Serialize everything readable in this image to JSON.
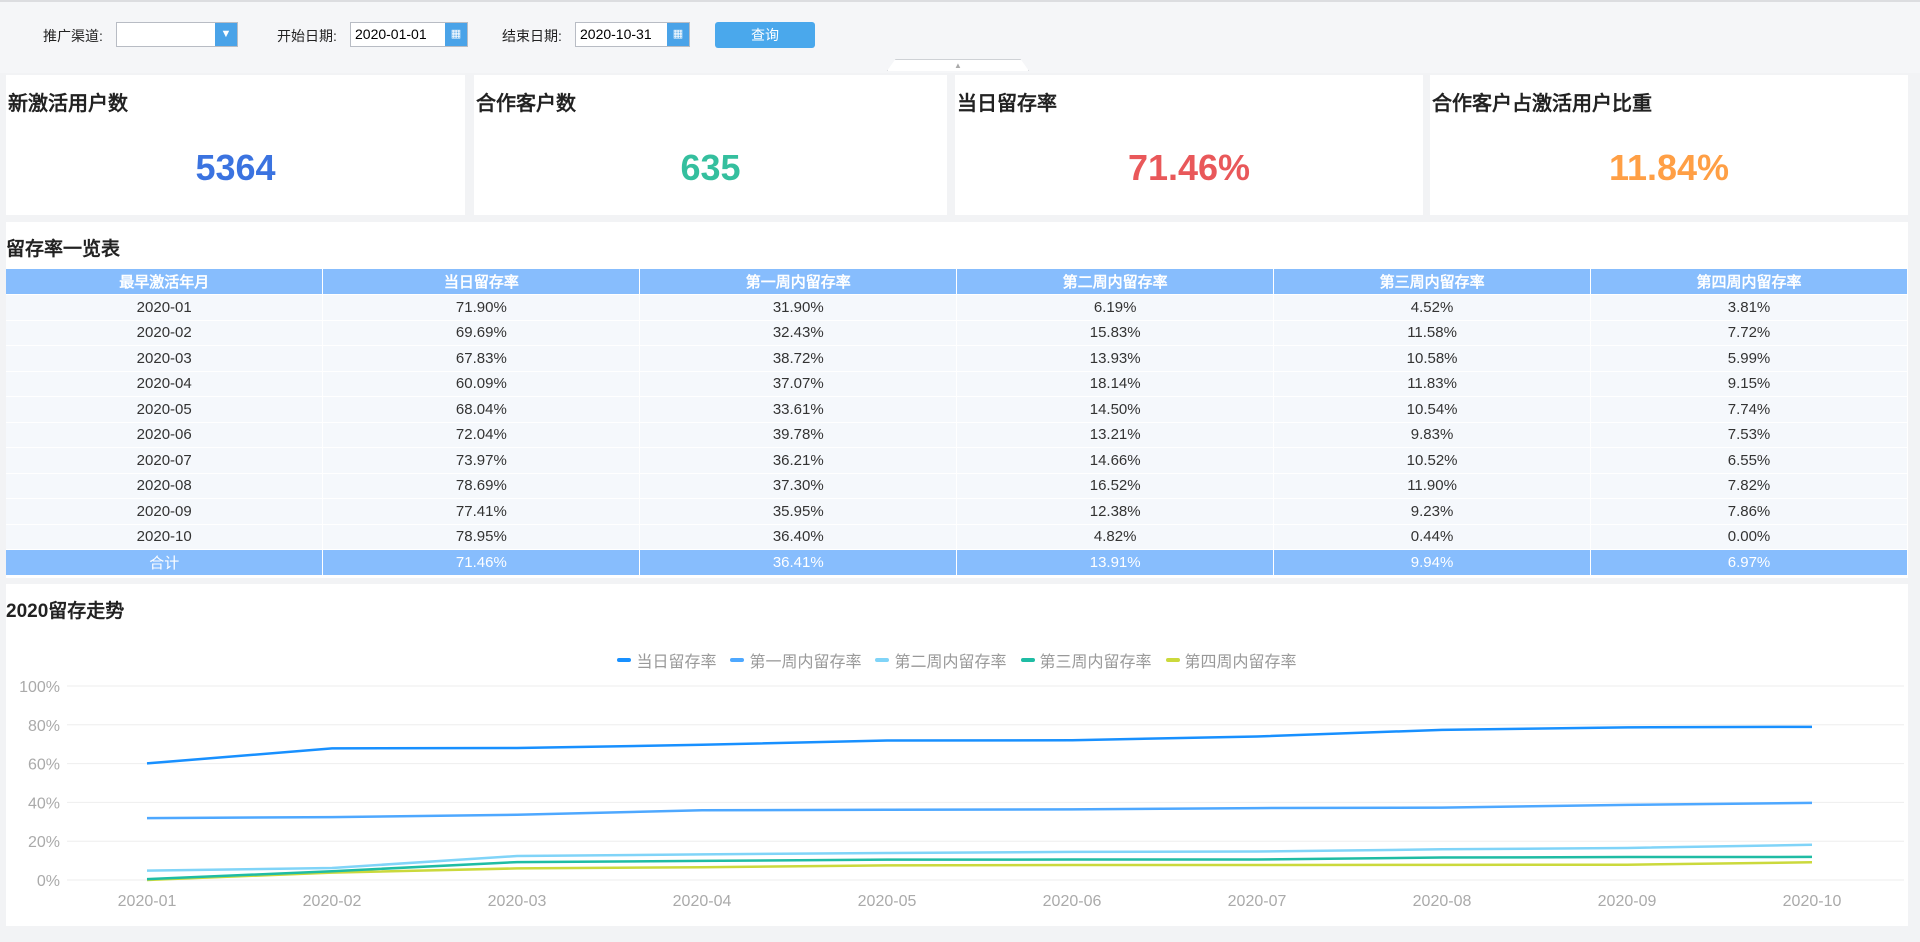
{
  "filters": {
    "channel_label": "推广渠道:",
    "channel_value": "",
    "start_label": "开始日期:",
    "start_value": "2020-01-01",
    "end_label": "结束日期:",
    "end_value": "2020-10-31",
    "query_button": "查询",
    "collapse_icon": "▲"
  },
  "cards": [
    {
      "title": "新激活用户数",
      "value": "5364",
      "color": "#3b73e0"
    },
    {
      "title": "合作客户数",
      "value": "635",
      "color": "#34bf9e"
    },
    {
      "title": "当日留存率",
      "value": "71.46%",
      "color": "#e9585a"
    },
    {
      "title": "合作客户占激活用户比重",
      "value": "11.84%",
      "color": "#ff9f45"
    }
  ],
  "table": {
    "title": "留存率一览表",
    "headers": [
      "最早激活年月",
      "当日留存率",
      "第一周内留存率",
      "第二周内留存率",
      "第三周内留存率",
      "第四周内留存率"
    ],
    "rows": [
      [
        "2020-01",
        "71.90%",
        "31.90%",
        "6.19%",
        "4.52%",
        "3.81%"
      ],
      [
        "2020-02",
        "69.69%",
        "32.43%",
        "15.83%",
        "11.58%",
        "7.72%"
      ],
      [
        "2020-03",
        "67.83%",
        "38.72%",
        "13.93%",
        "10.58%",
        "5.99%"
      ],
      [
        "2020-04",
        "60.09%",
        "37.07%",
        "18.14%",
        "11.83%",
        "9.15%"
      ],
      [
        "2020-05",
        "68.04%",
        "33.61%",
        "14.50%",
        "10.54%",
        "7.74%"
      ],
      [
        "2020-06",
        "72.04%",
        "39.78%",
        "13.21%",
        "9.83%",
        "7.53%"
      ],
      [
        "2020-07",
        "73.97%",
        "36.21%",
        "14.66%",
        "10.52%",
        "6.55%"
      ],
      [
        "2020-08",
        "78.69%",
        "37.30%",
        "16.52%",
        "11.90%",
        "7.82%"
      ],
      [
        "2020-09",
        "77.41%",
        "35.95%",
        "12.38%",
        "9.23%",
        "7.86%"
      ],
      [
        "2020-10",
        "78.95%",
        "36.40%",
        "4.82%",
        "0.44%",
        "0.00%"
      ]
    ],
    "total": [
      "合计",
      "71.46%",
      "36.41%",
      "13.91%",
      "9.94%",
      "6.97%"
    ]
  },
  "chart_title": "2020留存走势",
  "chart_data": {
    "type": "line",
    "title": "2020留存走势",
    "legend_position": "top-center",
    "grid": true,
    "x": [
      "2020-01",
      "2020-02",
      "2020-03",
      "2020-04",
      "2020-05",
      "2020-06",
      "2020-07",
      "2020-08",
      "2020-09",
      "2020-10"
    ],
    "ylim": [
      0,
      100
    ],
    "yticks": [
      "0%",
      "20%",
      "40%",
      "60%",
      "80%",
      "100%"
    ],
    "series": [
      {
        "name": "当日留存率",
        "color": "#1890ff",
        "values": [
          60.09,
          67.83,
          68.04,
          69.69,
          71.9,
          72.04,
          73.97,
          77.41,
          78.69,
          78.95
        ]
      },
      {
        "name": "第一周内留存率",
        "color": "#4ea8ff",
        "values": [
          31.9,
          32.43,
          33.61,
          35.95,
          36.21,
          36.4,
          37.07,
          37.3,
          38.72,
          39.78
        ]
      },
      {
        "name": "第二周内留存率",
        "color": "#80d4f8",
        "values": [
          4.82,
          6.19,
          12.38,
          13.21,
          13.93,
          14.5,
          14.66,
          15.83,
          16.52,
          18.14
        ]
      },
      {
        "name": "第三周内留存率",
        "color": "#1fbca4",
        "values": [
          0.44,
          4.52,
          9.23,
          9.83,
          10.52,
          10.54,
          10.58,
          11.58,
          11.83,
          11.9
        ]
      },
      {
        "name": "第四周内留存率",
        "color": "#cbd93c",
        "values": [
          0.0,
          3.81,
          5.99,
          6.55,
          7.53,
          7.72,
          7.74,
          7.82,
          7.86,
          9.15
        ]
      }
    ]
  }
}
